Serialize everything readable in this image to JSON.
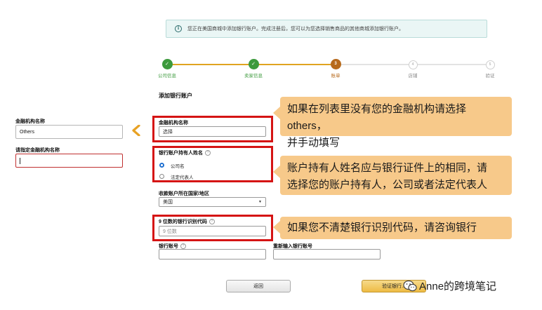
{
  "banner": {
    "text": "您正在美国商城中添加银行账户。完成注册后，您可以为您选择销售商品的其他商城添加银行账户。"
  },
  "stepper": {
    "steps": [
      {
        "label": "公司信息",
        "state": "done",
        "marker": "✓"
      },
      {
        "label": "卖家信息",
        "state": "done",
        "marker": "✓"
      },
      {
        "label": "账单",
        "state": "current",
        "marker": "3"
      },
      {
        "label": "店铺",
        "state": "todo",
        "marker": "4"
      },
      {
        "label": "验证",
        "state": "todo",
        "marker": "5"
      }
    ]
  },
  "form": {
    "section_title": "添加银行账户",
    "institution": {
      "label": "金融机构名称",
      "value": "选择"
    },
    "holder": {
      "label": "银行账户持有人姓名",
      "options": [
        {
          "label": "公司名",
          "checked": true
        },
        {
          "label": "法定代表人",
          "checked": false
        }
      ]
    },
    "country": {
      "label": "收款账户所在国家/地区",
      "value": "美国"
    },
    "bic": {
      "label": "9 位数的银行识别代码",
      "placeholder": "9 位数"
    },
    "account_number": {
      "label": "银行账号"
    },
    "account_number_confirm": {
      "label": "重新输入银行账号"
    }
  },
  "left_panel": {
    "institution": {
      "label": "金融机构名称",
      "value": "Others"
    },
    "specify": {
      "label": "请指定金融机构名称",
      "value": ""
    }
  },
  "callouts": {
    "institution": [
      "如果在列表里没有您的金融机构请选择 others，",
      "并手动填写"
    ],
    "holder": [
      "账户持有人姓名应与银行证件上的相同，请",
      "选择您的账户持有人，公司或者法定代表人"
    ],
    "bic": [
      "如果您不清楚银行识别代码，请咨询银行"
    ]
  },
  "buttons": {
    "back": "返回",
    "next": "验证银行..."
  },
  "watermark": {
    "text": "Anne的跨境笔记"
  },
  "colors": {
    "highlight_red": "#d51414",
    "callout_bg": "#f7c98a",
    "step_done": "#3d9a3d",
    "step_current": "#b76a1c",
    "chevron": "#e8a224"
  }
}
